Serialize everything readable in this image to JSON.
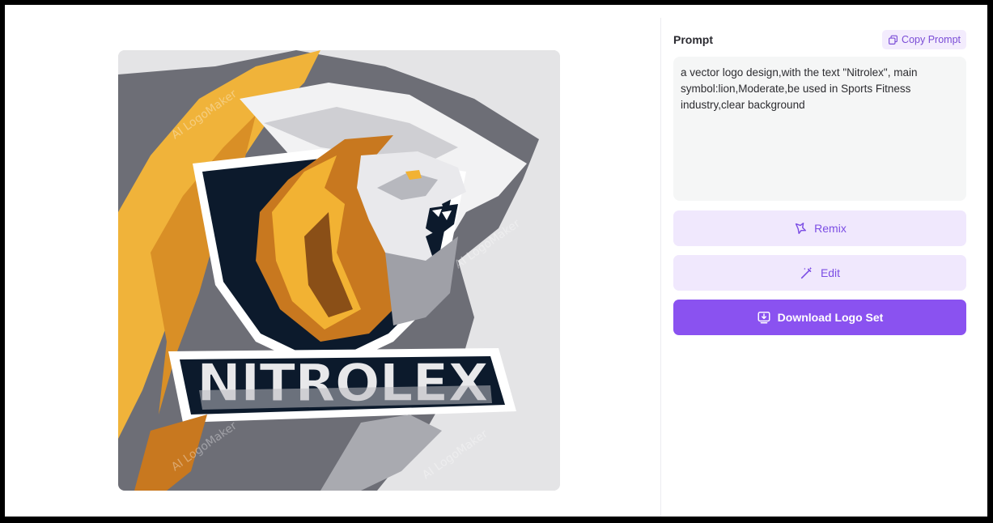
{
  "prompt": {
    "title": "Prompt",
    "copy_label": "Copy Prompt",
    "text": "a vector logo design,with the text \"Nitrolex\", main symbol:lion,Moderate,be used in Sports Fitness industry,clear background"
  },
  "actions": {
    "remix_label": "Remix",
    "edit_label": "Edit",
    "download_label": "Download Logo Set"
  },
  "logo": {
    "brand_text": "NITROLEX",
    "watermark": "AI LogoMaker",
    "colors": {
      "gold": "#f2b233",
      "orange": "#c8781f",
      "navy": "#0c1a2c",
      "grey": "#6b6d75",
      "light_grey": "#c9c9cd"
    }
  },
  "colors": {
    "accent": "#8a52f0",
    "accent_soft": "#f0e8fd",
    "accent_text": "#7c4ee4"
  }
}
